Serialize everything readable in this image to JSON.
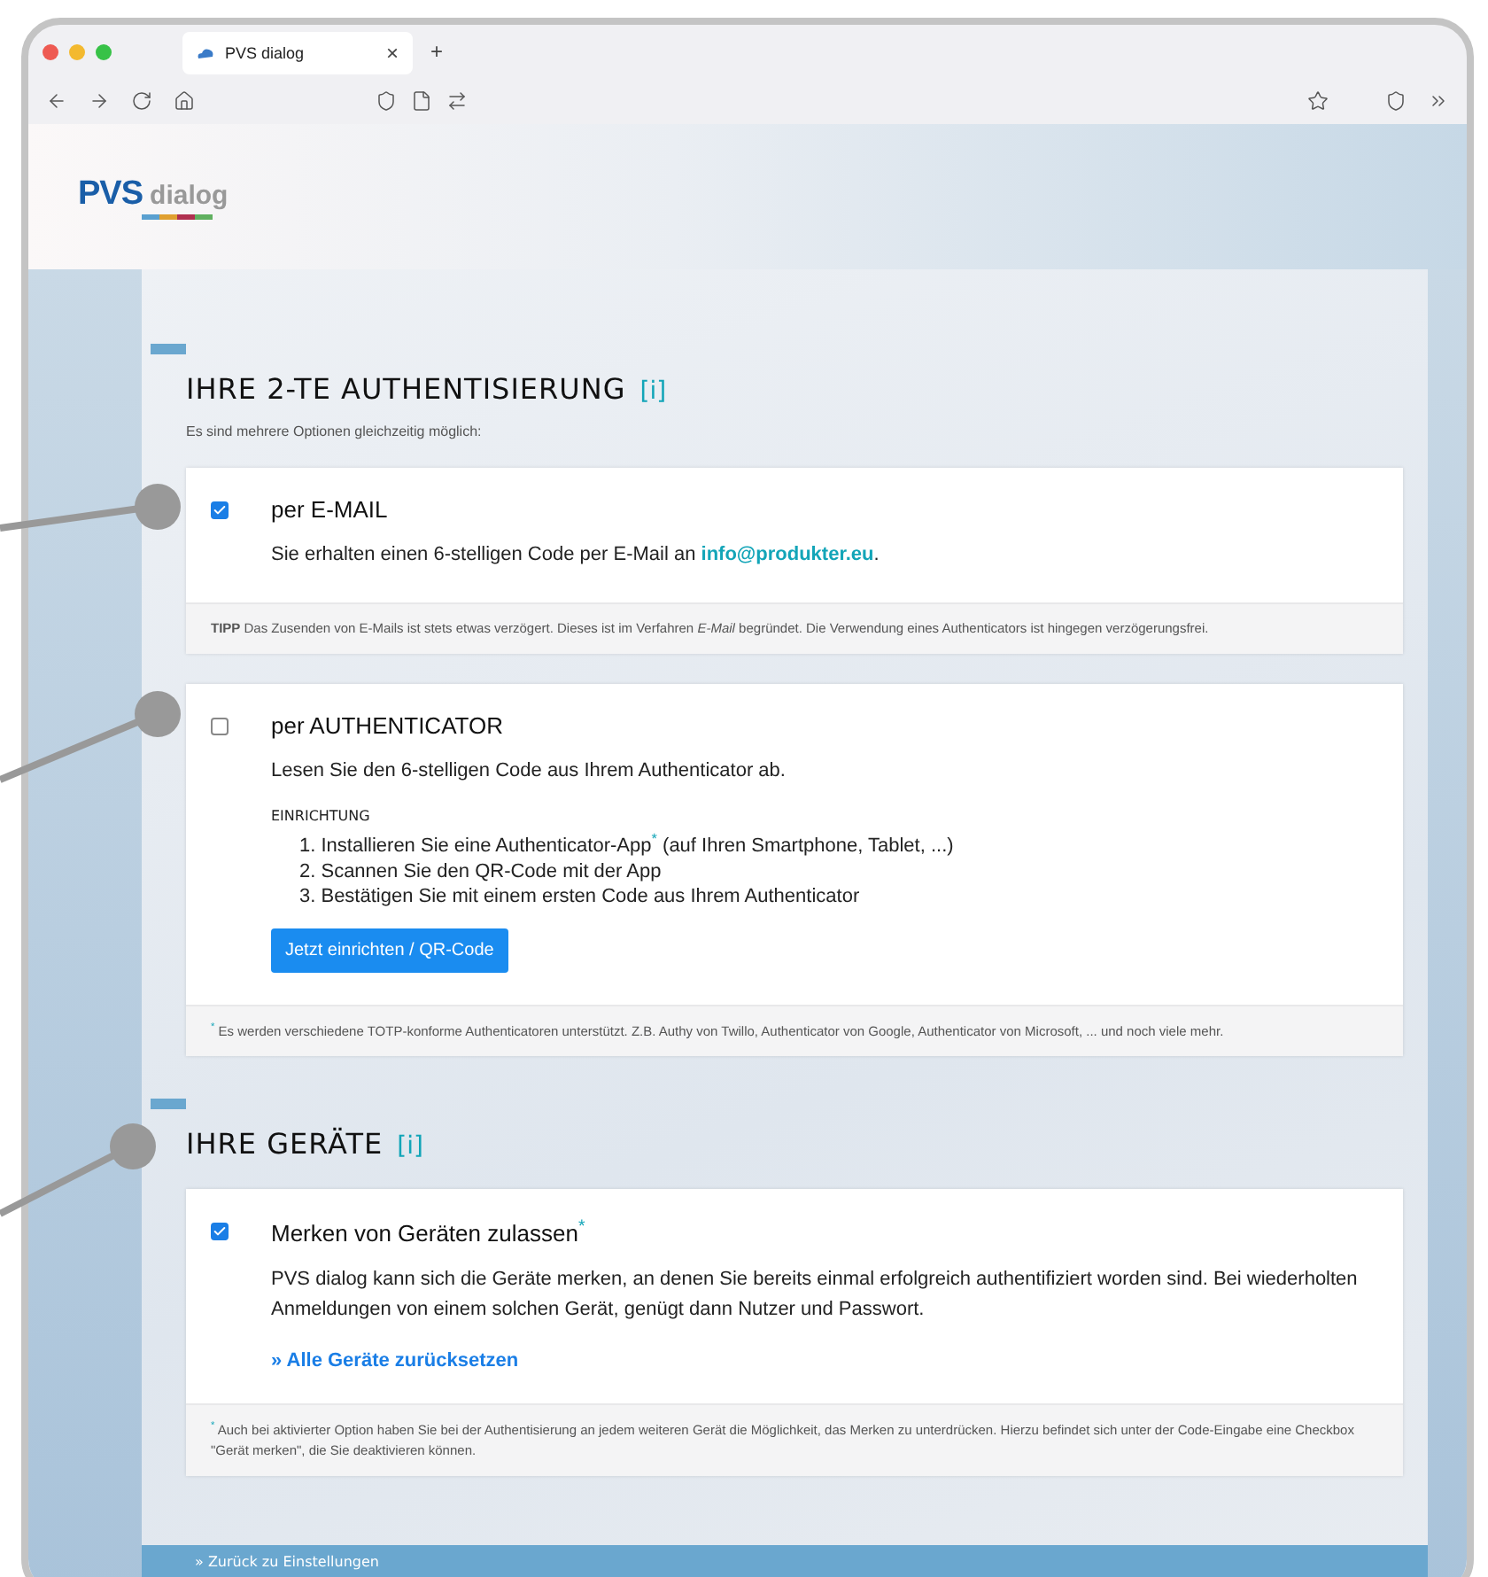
{
  "browser": {
    "tab_title": "PVS dialog",
    "tab_close": "×",
    "new_tab": "+"
  },
  "logo": {
    "brand": "PVS",
    "product": "dialog"
  },
  "sections": [
    {
      "heading": "IHRE 2-TE AUTHENTISIERUNG",
      "info": "[i]",
      "subtitle": "Es sind mehrere Optionen gleichzeitig möglich:",
      "cards": [
        {
          "checked": true,
          "title": "per E-MAIL",
          "description": "Sie erhalten einen 6-stelligen Code per E-Mail an",
          "email_link": "info@produkter.eu",
          "description_end": ".",
          "footnote": "**TIPP** Das Zusenden von E-Mails ist stets etwas verzögert. Dieses ist im Verfahren *E-Mail* begründet. Die Verwendung eines Authenticators ist hingegen verzögerungsfrei."
        },
        {
          "checked": false,
          "title": "per AUTHENTICATOR",
          "description": "Lesen Sie den 6-stelligen Code aus Ihrem Authenticator ab.",
          "setup_heading": "EINRICHTUNG",
          "setup_steps": [
            "1. Installieren Sie eine Authenticator-App$^{*}$ (auf Ihren Smartphone, Tablet, ...)",
            "2. Scannen Sie den QR-Code mit der App",
            "3. Bestätigen Sie mit einem ersten Code aus Ihrem Authenticator"
          ],
          "button": "Jetzt einrichten / QR-Code",
          "footnote": "$^{*}$ Es werden verschiedene TOTP-konforme Authenticatoren unterstützt. Z.B. Authy von Twillo, Authenticator von Google, Authenticator von Microsoft, ... und noch viele mehr."
        }
      ]
    },
    {
      "heading": "IHRE GERÄTE",
      "info": "[i]",
      "cards": [
        {
          "checked": true,
          "title": "Merken von Geräten zulassen$^{*}$",
          "description": "PVS dialog kann sich die Geräte merken, an denen Sie bereits einmal erfolgreich authentifiziert worden sind. Bei wiederholten Anmeldungen von einem solchen Gerät, genügt dann Nutzer und Passwort.",
          "link": "» Alle Geräte zurücksetzen",
          "footnote": "$^{*}$ Auch bei aktivierter Option haben Sie bei der Authentisierung an jedem weiteren Gerät die Möglichkeit, das Merken zu unterdrücken. Hierzu befindet sich unter der Code-Eingabe eine Checkbox \"Gerät merken\", die Sie deaktivieren können."
        }
      ]
    }
  ],
  "back_link": "» Zurück zu Einstellungen"
}
